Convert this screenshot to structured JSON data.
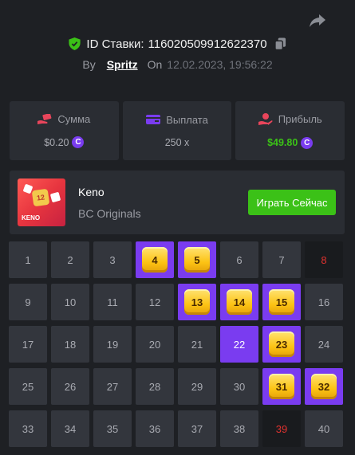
{
  "header": {
    "bet_id_label": "ID Ставки:",
    "bet_id": "116020509912622370",
    "by_label": "By",
    "username": "Spritz",
    "on_label": "On",
    "date": "12.02.2023, 19:56:22"
  },
  "stats": {
    "amount": {
      "label": "Сумма",
      "value": "$0.20"
    },
    "payout": {
      "label": "Выплата",
      "value": "250 x"
    },
    "profit": {
      "label": "Прибыль",
      "value": "$49.80"
    }
  },
  "colors": {
    "accent_purple": "#7a3cf0",
    "profit_green": "#3bc117",
    "miss_red": "#e1322f",
    "gem_gold": "#fcc314"
  },
  "game": {
    "thumb_number": "12",
    "thumb_tag": "KENO",
    "name": "Keno",
    "provider": "BC Originals",
    "play_label": "Играть Сейчас"
  },
  "grid": {
    "cells": [
      {
        "n": "1",
        "s": "normal"
      },
      {
        "n": "2",
        "s": "normal"
      },
      {
        "n": "3",
        "s": "normal"
      },
      {
        "n": "4",
        "s": "hit"
      },
      {
        "n": "5",
        "s": "hit"
      },
      {
        "n": "6",
        "s": "normal"
      },
      {
        "n": "7",
        "s": "normal"
      },
      {
        "n": "8",
        "s": "miss"
      },
      {
        "n": "9",
        "s": "normal"
      },
      {
        "n": "10",
        "s": "normal"
      },
      {
        "n": "11",
        "s": "normal"
      },
      {
        "n": "12",
        "s": "normal"
      },
      {
        "n": "13",
        "s": "hit"
      },
      {
        "n": "14",
        "s": "hit"
      },
      {
        "n": "15",
        "s": "hit"
      },
      {
        "n": "16",
        "s": "normal"
      },
      {
        "n": "17",
        "s": "normal"
      },
      {
        "n": "18",
        "s": "normal"
      },
      {
        "n": "19",
        "s": "normal"
      },
      {
        "n": "20",
        "s": "normal"
      },
      {
        "n": "21",
        "s": "normal"
      },
      {
        "n": "22",
        "s": "pick"
      },
      {
        "n": "23",
        "s": "hit"
      },
      {
        "n": "24",
        "s": "normal"
      },
      {
        "n": "25",
        "s": "normal"
      },
      {
        "n": "26",
        "s": "normal"
      },
      {
        "n": "27",
        "s": "normal"
      },
      {
        "n": "28",
        "s": "normal"
      },
      {
        "n": "29",
        "s": "normal"
      },
      {
        "n": "30",
        "s": "normal"
      },
      {
        "n": "31",
        "s": "hit"
      },
      {
        "n": "32",
        "s": "hit"
      },
      {
        "n": "33",
        "s": "normal"
      },
      {
        "n": "34",
        "s": "normal"
      },
      {
        "n": "35",
        "s": "normal"
      },
      {
        "n": "36",
        "s": "normal"
      },
      {
        "n": "37",
        "s": "normal"
      },
      {
        "n": "38",
        "s": "normal"
      },
      {
        "n": "39",
        "s": "miss"
      },
      {
        "n": "40",
        "s": "normal"
      }
    ]
  }
}
